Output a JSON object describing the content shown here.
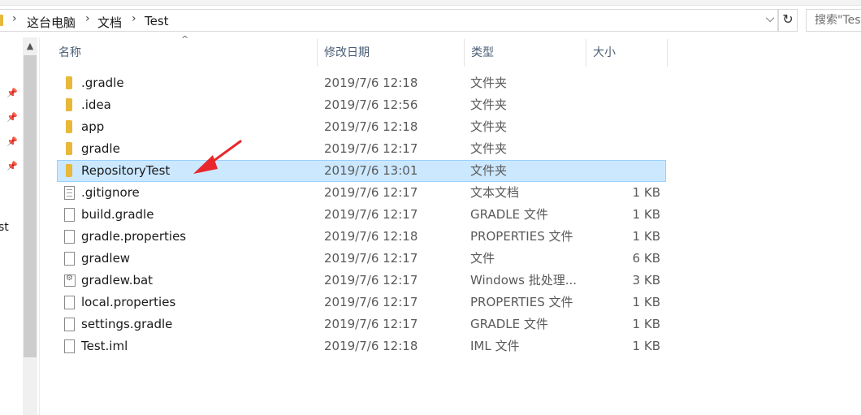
{
  "address": {
    "crumbs": [
      "这台电脑",
      "文档",
      "Test"
    ],
    "separator": "›",
    "dropdown_glyph": "⌵",
    "refresh_glyph": "↻"
  },
  "search": {
    "placeholder": "搜索\"Test\""
  },
  "nav": {
    "partial_item": "st"
  },
  "columns": {
    "name": "名称",
    "date": "修改日期",
    "type": "类型",
    "size": "大小"
  },
  "files": [
    {
      "name": ".gradle",
      "date": "2019/7/6 12:18",
      "type": "文件夹",
      "size": "",
      "icon": "folder-icon"
    },
    {
      "name": ".idea",
      "date": "2019/7/6 12:56",
      "type": "文件夹",
      "size": "",
      "icon": "folder-icon"
    },
    {
      "name": "app",
      "date": "2019/7/6 12:18",
      "type": "文件夹",
      "size": "",
      "icon": "folder-icon"
    },
    {
      "name": "gradle",
      "date": "2019/7/6 12:17",
      "type": "文件夹",
      "size": "",
      "icon": "folder-icon"
    },
    {
      "name": "RepositoryTest",
      "date": "2019/7/6 13:01",
      "type": "文件夹",
      "size": "",
      "icon": "folder-icon",
      "selected": true
    },
    {
      "name": ".gitignore",
      "date": "2019/7/6 12:17",
      "type": "文本文档",
      "size": "1 KB",
      "icon": "text-file-icon"
    },
    {
      "name": "build.gradle",
      "date": "2019/7/6 12:17",
      "type": "GRADLE 文件",
      "size": "1 KB",
      "icon": "file-icon"
    },
    {
      "name": "gradle.properties",
      "date": "2019/7/6 12:18",
      "type": "PROPERTIES 文件",
      "size": "1 KB",
      "icon": "file-icon"
    },
    {
      "name": "gradlew",
      "date": "2019/7/6 12:17",
      "type": "文件",
      "size": "6 KB",
      "icon": "file-icon"
    },
    {
      "name": "gradlew.bat",
      "date": "2019/7/6 12:17",
      "type": "Windows 批处理...",
      "size": "3 KB",
      "icon": "batch-file-icon"
    },
    {
      "name": "local.properties",
      "date": "2019/7/6 12:17",
      "type": "PROPERTIES 文件",
      "size": "1 KB",
      "icon": "file-icon"
    },
    {
      "name": "settings.gradle",
      "date": "2019/7/6 12:17",
      "type": "GRADLE 文件",
      "size": "1 KB",
      "icon": "file-icon"
    },
    {
      "name": "Test.iml",
      "date": "2019/7/6 12:18",
      "type": "IML 文件",
      "size": "1 KB",
      "icon": "file-icon"
    }
  ],
  "colors": {
    "selection": "#cce8ff",
    "selection_border": "#99d1ff",
    "folder": "#e8b83a",
    "arrow": "#e8262b"
  }
}
